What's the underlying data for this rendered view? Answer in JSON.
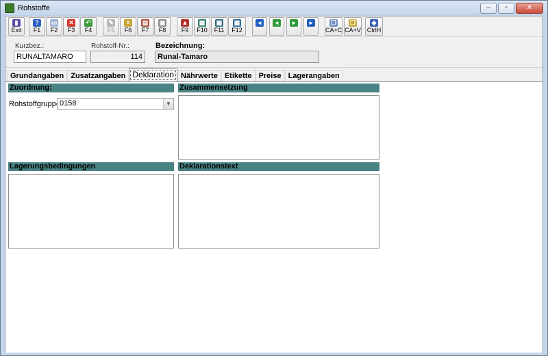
{
  "window": {
    "title": "Rohstoffe",
    "minimize": "‒",
    "maximize": "▫",
    "close": "✕"
  },
  "toolbar": {
    "buttons": [
      {
        "label": "Exit",
        "icon": "exit-icon",
        "color": "#5b4fa6",
        "glyph": "▮"
      },
      {
        "label": "F1",
        "icon": "help-icon",
        "color": "#2b5fc4",
        "glyph": "?"
      },
      {
        "label": "F2",
        "icon": "new-document-icon",
        "color": "#9fb6d8",
        "glyph": "▭"
      },
      {
        "label": "F3",
        "icon": "delete-icon",
        "color": "#d0342c",
        "glyph": "✕"
      },
      {
        "label": "F4",
        "icon": "undo-icon",
        "color": "#3a9a3a",
        "glyph": "↶"
      },
      {
        "label": "F5",
        "icon": "edit-icon",
        "color": "#b8b8b8",
        "glyph": "✎"
      },
      {
        "label": "F6",
        "icon": "list-icon",
        "color": "#c8a53a",
        "glyph": "≡"
      },
      {
        "label": "F7",
        "icon": "print-preview-icon",
        "color": "#a84a3a",
        "glyph": "▤"
      },
      {
        "label": "F8",
        "icon": "print-icon",
        "color": "#8a8a8a",
        "glyph": "▣"
      },
      {
        "label": "F9",
        "icon": "import-icon",
        "color": "#b0302a",
        "glyph": "▲"
      },
      {
        "label": "F10",
        "icon": "document-icon",
        "color": "#2f7d6d",
        "glyph": "▦"
      },
      {
        "label": "F11",
        "icon": "grid-icon",
        "color": "#2f6d7d",
        "glyph": "▦"
      },
      {
        "label": "F12",
        "icon": "calculator-icon",
        "color": "#2f6d9d",
        "glyph": "▦"
      },
      {
        "label": "",
        "icon": "first-record-icon",
        "color": "#1f5fbf",
        "glyph": "◂"
      },
      {
        "label": "",
        "icon": "previous-record-icon",
        "color": "#2f9a3a",
        "glyph": "◂"
      },
      {
        "label": "",
        "icon": "next-record-icon",
        "color": "#2f9a3a",
        "glyph": "▸"
      },
      {
        "label": "",
        "icon": "last-record-icon",
        "color": "#1f5fbf",
        "glyph": "▸"
      },
      {
        "label": "CA+C",
        "icon": "copy-icon",
        "color": "#6f8fb8",
        "glyph": "❐"
      },
      {
        "label": "CA+V",
        "icon": "paste-icon",
        "color": "#c8a53a",
        "glyph": "❐"
      },
      {
        "label": "CtrlH",
        "icon": "diamond-icon",
        "color": "#3a5fb8",
        "glyph": "◆"
      }
    ]
  },
  "header": {
    "kurzbez_label": "Kurzbez.:",
    "kurzbez_value": "RUNALTAMARO",
    "nr_label": "Rohstoff-Nr.:",
    "nr_value": "114",
    "bezeichnung_label": "Bezeichnung:",
    "bezeichnung_value": "Runal-Tamaro"
  },
  "tabs": [
    {
      "label": "Grundangaben",
      "active": false
    },
    {
      "label": "Zusatzangaben",
      "active": false
    },
    {
      "label": "Deklaration",
      "active": true
    },
    {
      "label": "Nährwerte",
      "active": false
    },
    {
      "label": "Etikette",
      "active": false
    },
    {
      "label": "Preise",
      "active": false
    },
    {
      "label": "Lagerangaben",
      "active": false
    }
  ],
  "panel": {
    "zuordnung": "Zuordnung:",
    "rohstoffgruppe_label": "Rohstoffgruppe:",
    "rohstoffgruppe_value": "0158",
    "zusammensetzung": "Zusammensetzung",
    "lagerungsbedingungen": "Lagerungsbedingungen",
    "deklarationstext": "Deklarationstext"
  },
  "colors": {
    "section_header": "#4a8384",
    "window_frame": "#c5d5e8"
  }
}
